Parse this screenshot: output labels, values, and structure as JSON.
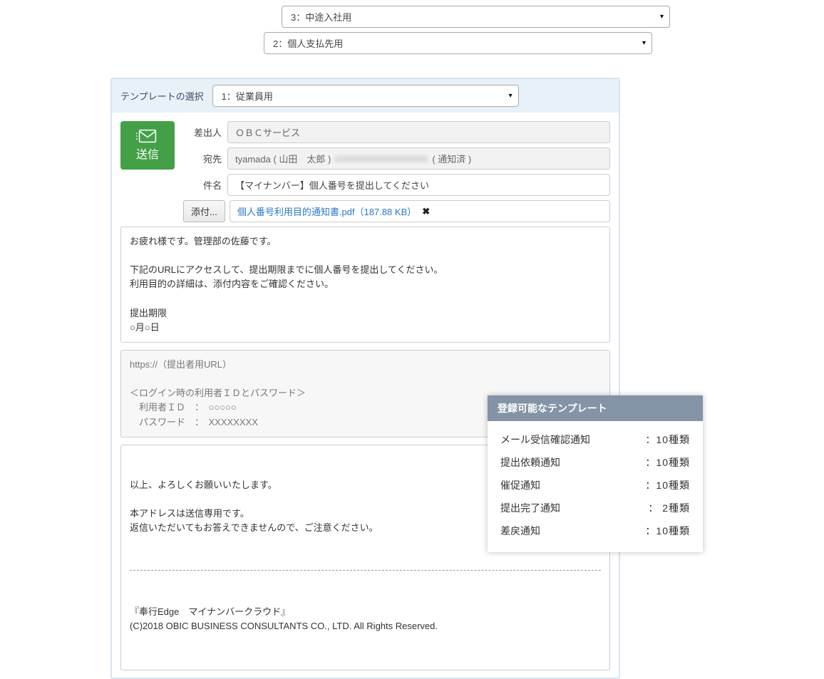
{
  "dropdowns": {
    "d3": "3：中途入社用",
    "d2": "2：個人支払先用",
    "header_label": "テンプレートの選択",
    "d1": "1：従業員用"
  },
  "send_label": "送信",
  "fields": {
    "from_label": "差出人",
    "from_value": "ＯＢＣサービス",
    "to_label": "宛先",
    "to_value_pre": "tyamada ( 山田　太郎 )  ",
    "to_value_post": " ( 通知済 )",
    "subject_label": "件名",
    "subject_value": "【マイナンバー】個人番号を提出してください",
    "attach_btn": "添付...",
    "attach_name": "個人番号利用目的通知書.pdf（187.88 KB）",
    "attach_remove": "✖"
  },
  "body1": "お疲れ様です。管理部の佐藤です。\n\n下記のURLにアクセスして、提出期限までに個人番号を提出してください。\n利用目的の詳細は、添付内容をご確認ください。\n\n提出期限\n○月○日",
  "body2": "https://（提出者用URL）\n\n＜ログイン時の利用者ＩＤとパスワード＞\n　利用者ＩＤ　：　○○○○○\n　パスワード　：　XXXXXXXX",
  "body3_a": "以上、よろしくお願いいたします。\n\n本アドレスは送信専用です。\n返信いただいてもお答えできませんので、ご注意ください。",
  "body3_b": "『奉行Edge　マイナンバークラウド』\n(C)2018 OBIC BUSINESS CONSULTANTS CO., LTD. All Rights Reserved.",
  "popup": {
    "title": "登録可能なテンプレート",
    "rows": [
      {
        "k": "メール受信確認通知",
        "v": "：10種類"
      },
      {
        "k": "提出依頼通知",
        "v": "：10種類"
      },
      {
        "k": "催促通知",
        "v": "：10種類"
      },
      {
        "k": "提出完了通知",
        "v": "：  2種類"
      },
      {
        "k": "差戻通知",
        "v": "：10種類"
      }
    ]
  }
}
